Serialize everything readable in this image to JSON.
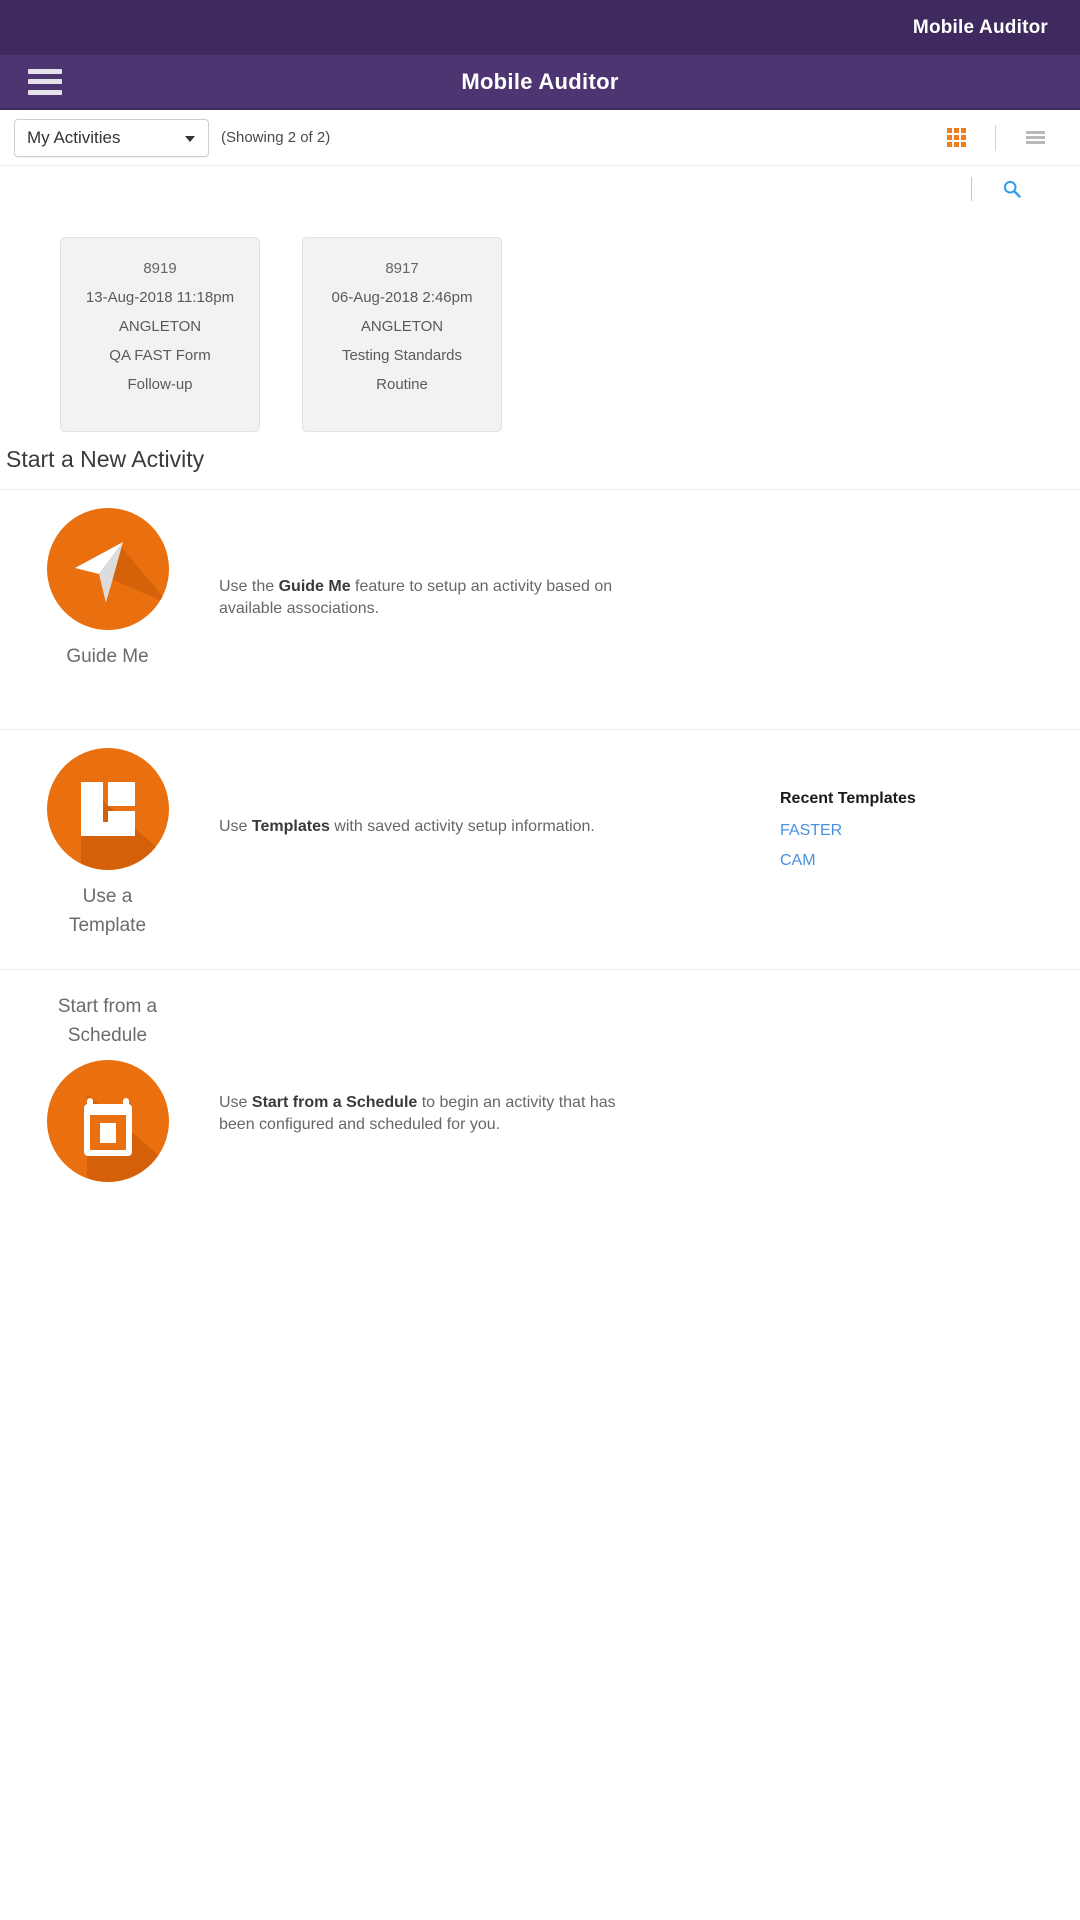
{
  "statusbar": {
    "brand": "Mobile Auditor"
  },
  "navbar": {
    "title": "Mobile Auditor",
    "menu_icon": "hamburger-menu-icon"
  },
  "toolbar": {
    "filter_selected": "My Activities",
    "filter_options": [
      "My Activities"
    ],
    "showing_text": "(Showing 2 of 2)",
    "grid_view_icon": "grid-view-icon",
    "list_view_icon": "list-view-icon",
    "active_view": "grid",
    "search_icon": "search-icon"
  },
  "colors": {
    "statusbar_purple": "#3e2a5e",
    "navbar_purple": "#4c3570",
    "accent_orange": "#ea6f0e",
    "grid_icon_orange": "#f07d1a",
    "link_blue": "#4a90e2",
    "card_grey": "#f2f2f2"
  },
  "activities": [
    {
      "id": "8919",
      "datetime": "13-Aug-2018 11:18pm",
      "location": "ANGLETON",
      "form": "QA FAST Form",
      "type": "Follow-up"
    },
    {
      "id": "8917",
      "datetime": "06-Aug-2018 2:46pm",
      "location": "ANGLETON",
      "form": "Testing Standards",
      "type": "Routine"
    }
  ],
  "new_activity": {
    "heading": "Start a New Activity",
    "guide_me": {
      "label": "Guide Me",
      "icon": "paper-plane-icon",
      "desc_pre": "Use the ",
      "desc_bold": "Guide Me",
      "desc_post": " feature to setup an activity based on available associations."
    },
    "template": {
      "label_line1": "Use a",
      "label_line2": "Template",
      "icon": "layout-template-icon",
      "desc_pre": "Use ",
      "desc_bold": "Templates",
      "desc_post": " with saved activity setup information.",
      "recent_title": "Recent Templates",
      "recent_items": [
        "FASTER",
        "CAM"
      ]
    },
    "schedule": {
      "label_line1": "Start from a",
      "label_line2": "Schedule",
      "icon": "calendar-icon",
      "desc_pre": "Use ",
      "desc_bold": "Start from a Schedule",
      "desc_post": " to begin an activity that has been configured and scheduled for you."
    }
  }
}
